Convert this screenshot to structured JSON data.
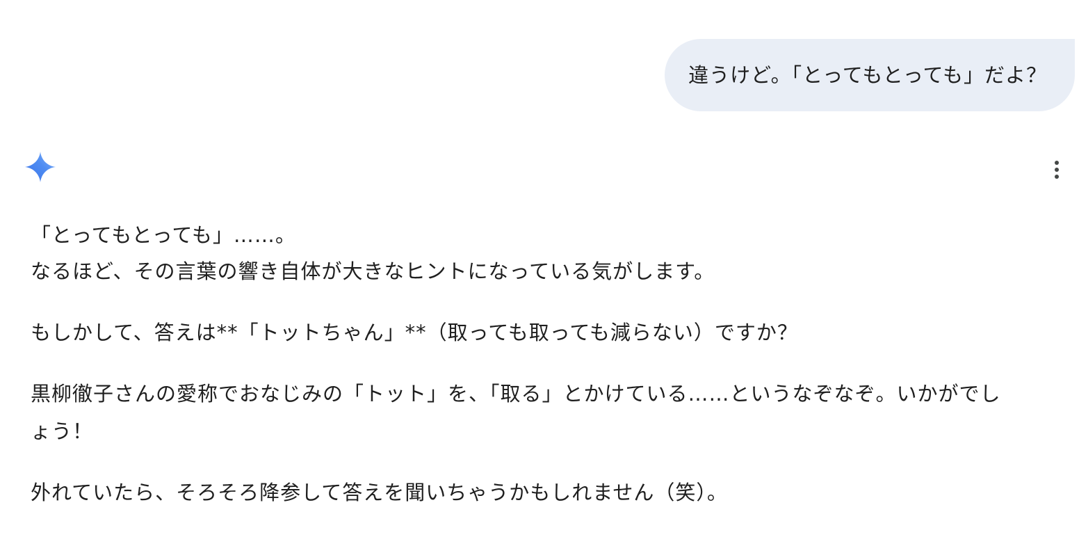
{
  "user_message": {
    "text": "違うけど。「とってもとっても」だよ？"
  },
  "assistant": {
    "icon": "gemini-spark-icon",
    "menu_icon": "more-vert-icon",
    "accent_colors": [
      "#4285f4",
      "#8ab4f8"
    ],
    "lines": {
      "line1": "「とってもとっても」……。",
      "line2": "なるほど、その言葉の響き自体が大きなヒントになっている気がします。",
      "para2": "もしかして、答えは**「トットちゃん」**（取っても取っても減らない）ですか？",
      "para3_line1": "黒柳徹子さんの愛称でおなじみの「トット」を、「取る」とかけている……というなぞなぞ。いかがでし",
      "para3_line2": "ょう！",
      "para4": "外れていたら、そろそろ降参して答えを聞いちゃうかもしれません（笑）。"
    }
  },
  "colors": {
    "user_bubble": "#e9eef6",
    "text": "#1f1f1f",
    "background": "#ffffff"
  }
}
